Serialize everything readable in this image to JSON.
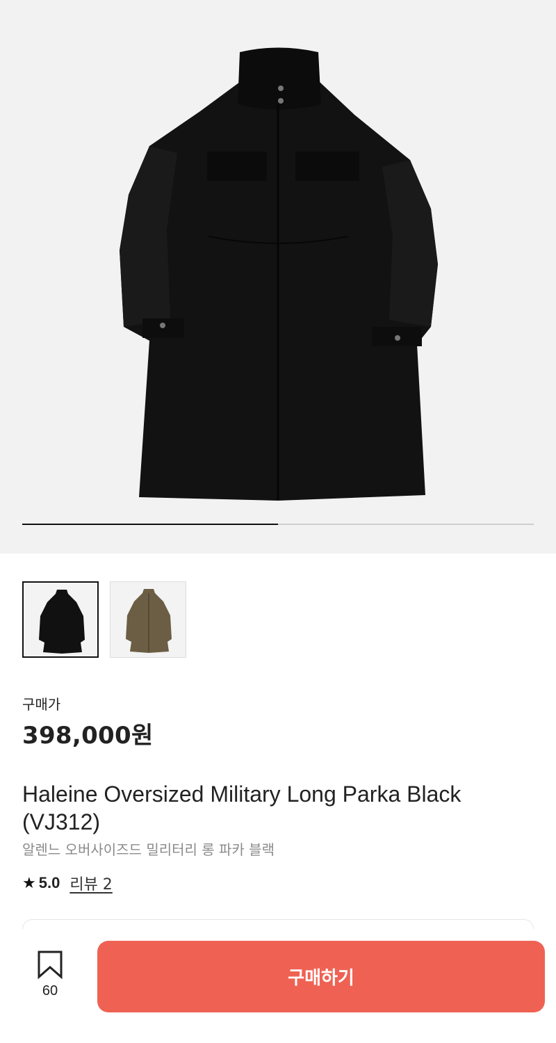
{
  "gallery": {
    "progress_fraction": 0.5,
    "thumbnails": [
      {
        "name": "black-coat",
        "color": "#111111",
        "selected": true
      },
      {
        "name": "khaki-coat",
        "color": "#6b5e44",
        "selected": false
      }
    ]
  },
  "product": {
    "price_label": "구매가",
    "price": "398,000원",
    "title_en": "Haleine Oversized Military Long Parka Black (VJ312)",
    "title_ko": "알렌느 오버사이즈드 밀리터리 롱 파카 블랙",
    "rating_score": "5.0",
    "review_link": "리뷰 2"
  },
  "bottom_bar": {
    "bookmark_count": "60",
    "buy_label": "구매하기"
  },
  "colors": {
    "accent": "#ef6253",
    "hero_bg": "#f2f2f2"
  }
}
